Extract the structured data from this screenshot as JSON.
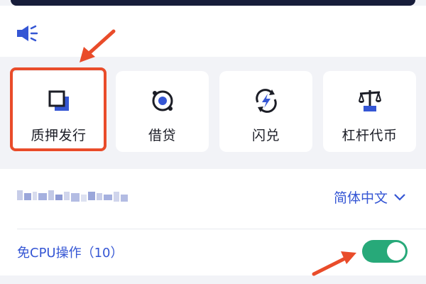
{
  "header": {
    "speaker_icon": "speaker-icon"
  },
  "features": [
    {
      "label": "质押发行",
      "icon": "collateral-issue-icon"
    },
    {
      "label": "借贷",
      "icon": "lending-icon"
    },
    {
      "label": "闪兑",
      "icon": "flash-swap-icon"
    },
    {
      "label": "杠杆代币",
      "icon": "leverage-token-icon"
    }
  ],
  "settings": {
    "language": {
      "value": "简体中文",
      "icon": "chevron-down-icon"
    },
    "cpu_free": {
      "label": "免CPU操作（10）",
      "enabled": true
    }
  },
  "colors": {
    "accent": "#3556d4",
    "toggle_on": "#27a979",
    "annotation": "#e94c2a"
  }
}
